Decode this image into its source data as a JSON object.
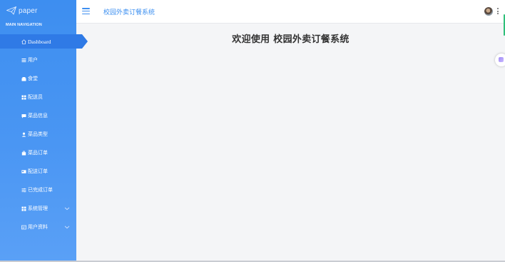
{
  "sidebar": {
    "logo_text": "paper",
    "nav_header": "MAIN NAVIGATION",
    "items": [
      {
        "label": "Dashboard",
        "icon": "home-icon"
      },
      {
        "label": "用户",
        "icon": "list-icon"
      },
      {
        "label": "食堂",
        "icon": "store-icon"
      },
      {
        "label": "配送员",
        "icon": "grid-icon"
      },
      {
        "label": "菜品信息",
        "icon": "message-icon"
      },
      {
        "label": "菜品类型",
        "icon": "user-icon"
      },
      {
        "label": "菜品订单",
        "icon": "bag-icon"
      },
      {
        "label": "配送订单",
        "icon": "card-icon"
      },
      {
        "label": "已完成订单",
        "icon": "sliders-icon"
      },
      {
        "label": "系统管理",
        "icon": "grid-icon"
      },
      {
        "label": "用户资料",
        "icon": "profile-card-icon"
      }
    ]
  },
  "header": {
    "title": "校园外卖订餐系统"
  },
  "main": {
    "welcome": "欢迎使用 校园外卖订餐系统"
  },
  "colors": {
    "sidebar": "#4a96f3",
    "active": "#2f7ae6",
    "accent": "#3a8ef0"
  }
}
